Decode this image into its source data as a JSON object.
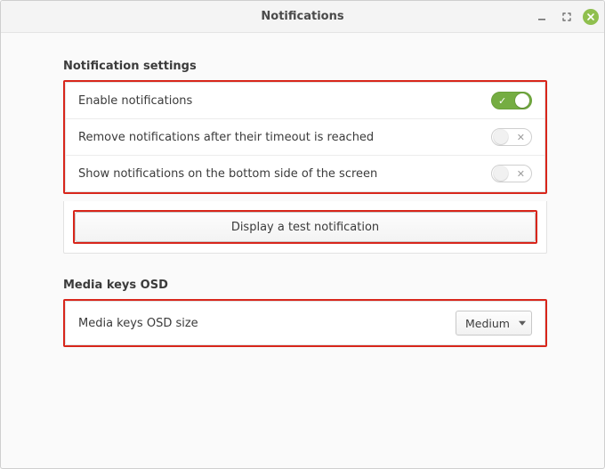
{
  "window": {
    "title": "Notifications"
  },
  "sections": {
    "notification": {
      "heading": "Notification settings",
      "rows": {
        "enable": {
          "label": "Enable notifications",
          "on": true
        },
        "remove_timeout": {
          "label": "Remove notifications after their timeout is reached",
          "on": false
        },
        "bottom": {
          "label": "Show notifications on the bottom side of the screen",
          "on": false
        }
      },
      "test_button": "Display a test notification"
    },
    "osd": {
      "heading": "Media keys OSD",
      "row_label": "Media keys OSD size",
      "selected": "Medium"
    }
  }
}
